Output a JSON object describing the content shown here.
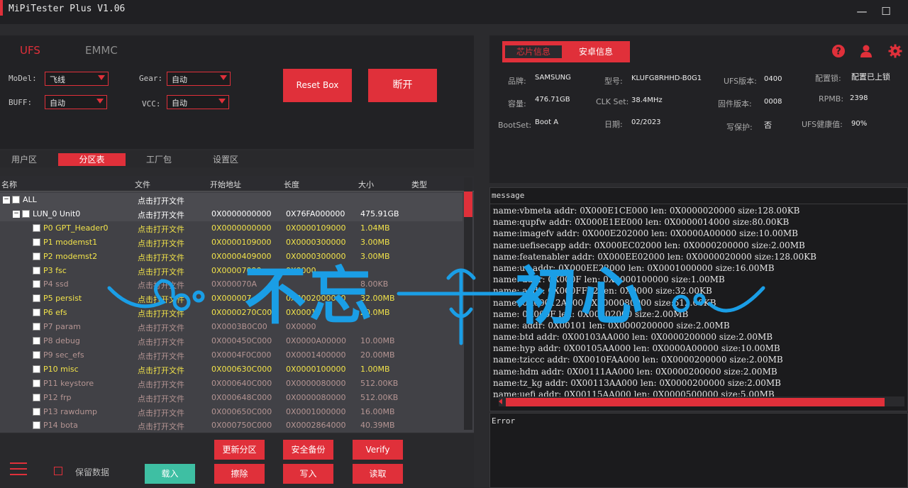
{
  "window": {
    "title": "MiPiTester Plus V1.06",
    "minimize_glyph": "—",
    "maximize_glyph": "☐"
  },
  "mode_tabs": [
    {
      "label": "UFS",
      "active": true
    },
    {
      "label": "EMMC",
      "active": false
    }
  ],
  "settings": {
    "model_label": "MoDel:",
    "model_value": "飞线",
    "buff_label": "BUFF:",
    "buff_value": "自动",
    "gear_label": "Gear:",
    "gear_value": "自动",
    "vcc_label": "VCC:",
    "vcc_value": "自动",
    "reset_label": "Reset Box",
    "disconnect_label": "断开"
  },
  "sub_tabs": [
    {
      "label": "用户区",
      "active": false
    },
    {
      "label": "分区表",
      "active": true
    },
    {
      "label": "工厂包",
      "active": false
    },
    {
      "label": "设置区",
      "active": false
    }
  ],
  "table": {
    "headers": [
      "名称",
      "文件",
      "开始地址",
      "长度",
      "大小",
      "类型"
    ],
    "rows": [
      {
        "name": "ALL",
        "file": "点击打开文件",
        "start": "",
        "length": "",
        "size": "",
        "level": 0,
        "style": "root"
      },
      {
        "name": "LUN_0 Unit0",
        "file": "点击打开文件",
        "start": "0X0000000000",
        "length": "0X76FA000000",
        "size": "475.91GB",
        "level": 1,
        "style": "root"
      },
      {
        "name": "P0 GPT_Header0",
        "file": "点击打开文件",
        "start": "0X0000000000",
        "length": "0X0000109000",
        "size": "1.04MB",
        "level": 2,
        "style": "hi"
      },
      {
        "name": "P1 modemst1",
        "file": "点击打开文件",
        "start": "0X0000109000",
        "length": "0X0000300000",
        "size": "3.00MB",
        "level": 2,
        "style": "hi"
      },
      {
        "name": "P2 modemst2",
        "file": "点击打开文件",
        "start": "0X0000409000",
        "length": "0X0000300000",
        "size": "3.00MB",
        "level": 2,
        "style": "hi"
      },
      {
        "name": "P3 fsc",
        "file": "点击打开文件",
        "start": "0X00007090",
        "length": "0X0000",
        "size": "",
        "level": 2,
        "style": "hi"
      },
      {
        "name": "P4 ssd",
        "file": "点击打开文件",
        "start": "0X000070A",
        "length": "",
        "size": "8.00KB",
        "level": 2,
        "style": "lo"
      },
      {
        "name": "P5 persist",
        "file": "点击打开文件",
        "start": "0X000007",
        "length": "0X0002000000",
        "size": "32.00MB",
        "level": 2,
        "style": "hi"
      },
      {
        "name": "P6 efs",
        "file": "点击打开文件",
        "start": "0X0000270C00",
        "length": "0X00014",
        "size": "20.0MB",
        "level": 2,
        "style": "hi"
      },
      {
        "name": "P7 param",
        "file": "点击打开文件",
        "start": "0X0003B0C00",
        "length": "0X0000",
        "size": "",
        "level": 2,
        "style": "lo"
      },
      {
        "name": "P8 debug",
        "file": "点击打开文件",
        "start": "0X000450C000",
        "length": "0X0000A00000",
        "size": "10.00MB",
        "level": 2,
        "style": "lo"
      },
      {
        "name": "P9 sec_efs",
        "file": "点击打开文件",
        "start": "0X0004F0C000",
        "length": "0X0001400000",
        "size": "20.00MB",
        "level": 2,
        "style": "lo"
      },
      {
        "name": "P10 misc",
        "file": "点击打开文件",
        "start": "0X000630C000",
        "length": "0X0000100000",
        "size": "1.00MB",
        "level": 2,
        "style": "hi"
      },
      {
        "name": "P11 keystore",
        "file": "点击打开文件",
        "start": "0X000640C000",
        "length": "0X0000080000",
        "size": "512.00KB",
        "level": 2,
        "style": "lo"
      },
      {
        "name": "P12 frp",
        "file": "点击打开文件",
        "start": "0X000648C000",
        "length": "0X0000080000",
        "size": "512.00KB",
        "level": 2,
        "style": "lo"
      },
      {
        "name": "P13 rawdump",
        "file": "点击打开文件",
        "start": "0X000650C000",
        "length": "0X0001000000",
        "size": "16.00MB",
        "level": 2,
        "style": "lo"
      },
      {
        "name": "P14 bota",
        "file": "点击打开文件",
        "start": "0X000750C000",
        "length": "0X0002864000",
        "size": "40.39MB",
        "level": 2,
        "style": "lo"
      }
    ]
  },
  "actions": {
    "keep_data_label": "保留数据",
    "load": "载入",
    "update_partition": "更新分区",
    "erase": "擦除",
    "safe_backup": "安全备份",
    "write": "写入",
    "verify": "Verify",
    "read": "读取"
  },
  "info_tabs": [
    {
      "label": "芯片信息",
      "active": true
    },
    {
      "label": "安卓信息",
      "active": false
    }
  ],
  "chip_info": {
    "brand_label": "品牌:",
    "brand": "SAMSUNG",
    "model_label": "型号:",
    "model": "KLUFG8RHHD-B0G1",
    "ufs_ver_label": "UFS版本:",
    "ufs_ver": "0400",
    "config_lock_label": "配置锁:",
    "config_lock": "配置已上锁",
    "capacity_label": "容量:",
    "capacity": "476.71GB",
    "clk_label": "CLK Set:",
    "clk": "38.4MHz",
    "fw_label": "固件版本:",
    "fw": "0008",
    "rpmb_label": "RPMB:",
    "rpmb": "2398",
    "bootset_label": "BootSet:",
    "bootset": "Boot A",
    "date_label": "日期:",
    "date": "02/2023",
    "wp_label": "写保护:",
    "wp": "否",
    "health_label": "UFS健康值:",
    "health": "90%"
  },
  "message": {
    "title": "message",
    "lines": [
      "name:vbmeta addr: 0X000E1CE000  len: 0X0000020000  size:128.00KB",
      "name:qupfw addr: 0X000E1EE000  len: 0X0000014000  size:80.00KB",
      "name:imagefv addr: 0X000E202000  len: 0X0000A00000  size:10.00MB",
      "name:uefisecapp addr: 0X000EC02000  len: 0X0000200000  size:2.00MB",
      "name:featenabler addr: 0X000EE02000  len: 0X0000020000  size:128.00KB",
      "name:ue     addr: 0X000EE22000  len: 0X0001000000  size:16.00MB",
      "name:       addr: 0X000F      len: 0X0000100000  size:1.00MB",
      "name:       addr: 0X000FF22     len: 0X0000       size:32.00KB",
      "name:             0X00012A000   0X0000080000  size:512.00KB",
      "name:         0X000F     len: 0X00002000    size:2.00MB",
      "name:       addr: 0X00101     len: 0X0000200000  size:2.00MB",
      "name:btd addr: 0X00103AA000  len: 0X0000200000  size:2.00MB",
      "name:hyp addr: 0X00105AA000  len: 0X0000A00000  size:10.00MB",
      "name:tziccc addr: 0X0010FAA000  len: 0X0000200000  size:2.00MB",
      "name:hdm addr: 0X00111AA000  len: 0X0000200000  size:2.00MB",
      "name:tz_kg addr: 0X00113AA000  len: 0X0000200000  size:2.00MB",
      "name:uefi addr: 0X00115AA000  len: 0X0000500000  size:5.00MB"
    ]
  },
  "error": {
    "title": "Error"
  },
  "watermark": {
    "left_text": "不忘",
    "right_text": "初心"
  },
  "colors": {
    "accent": "#e0303a",
    "highlight_text": "#f2e34a",
    "dim_text": "#b59593",
    "green": "#3ebfa3",
    "watermark": "#1a9ee6"
  },
  "icons": [
    "help-icon",
    "user-icon",
    "gear-icon",
    "menu-icon"
  ]
}
